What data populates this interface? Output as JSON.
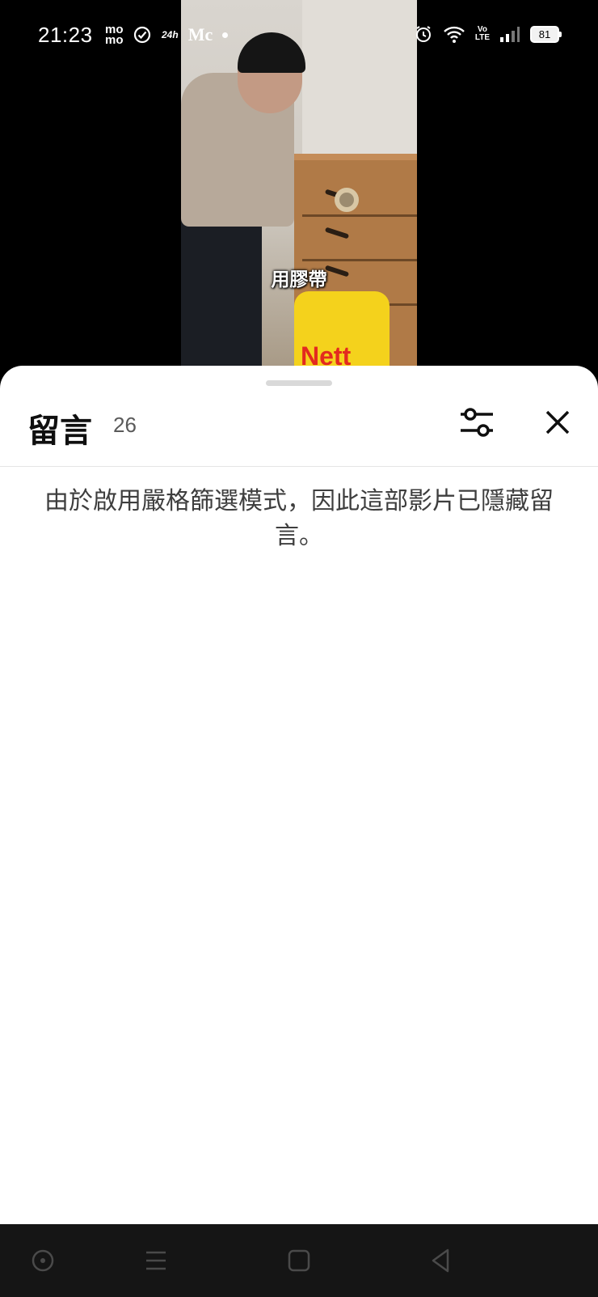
{
  "status_bar": {
    "time": "21:23",
    "left_icons": [
      "momo-app-icon",
      "check-circle-icon",
      "24h-app-icon",
      "mc-app-icon",
      "notification-dot-icon"
    ],
    "mo_label_top": "mo",
    "mo_label_bottom": "mo",
    "h24_label": "24h",
    "mc_label": "Mc",
    "right_icons": [
      "alarm-icon",
      "wifi-icon",
      "volte-icon",
      "signal-icon",
      "battery-icon"
    ],
    "volte_top": "Vo",
    "volte_bottom": "LTE",
    "battery_level": "81"
  },
  "video": {
    "caption": "用膠帶",
    "bag_text": "Nett"
  },
  "comments_sheet": {
    "title": "留言",
    "count": "26",
    "notice": "由於啟用嚴格篩選模式，因此這部影片已隱藏留言。"
  },
  "nav_bar": {
    "buttons": [
      "assistant-icon",
      "recents-icon",
      "home-icon",
      "back-icon"
    ]
  }
}
